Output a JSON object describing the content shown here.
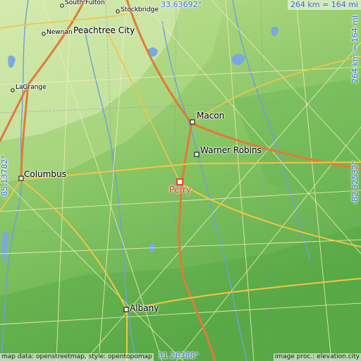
{
  "map": {
    "scale_label": "264 km = 164 mi",
    "coords": {
      "top": "33.63692°",
      "bottom": "31.26388°",
      "left": "-85.13782°",
      "right": "-82.32532°"
    },
    "highlight": {
      "name": "Perry",
      "color": "#e8372e"
    },
    "cities": [
      {
        "key": "south_fulton",
        "name": "South Fulton",
        "size": "small"
      },
      {
        "key": "stockbridge",
        "name": "Stockbridge",
        "size": "small"
      },
      {
        "key": "newnan",
        "name": "Newnan",
        "size": "small"
      },
      {
        "key": "peachtree_city",
        "name": "Peachtree City",
        "size": "large"
      },
      {
        "key": "lagrange",
        "name": "LaGrange",
        "size": "small"
      },
      {
        "key": "macon",
        "name": "Macon",
        "size": "large"
      },
      {
        "key": "warner_robins",
        "name": "Warner Robins",
        "size": "large"
      },
      {
        "key": "columbus",
        "name": "Columbus",
        "size": "large"
      },
      {
        "key": "albany",
        "name": "Albany",
        "size": "large"
      }
    ],
    "attribution_left": "map data: openstreetmap, style: opentopomap",
    "attribution_right": "image proc.: elevation.city",
    "colors": {
      "lowland": "#6fb956",
      "midland": "#8fc765",
      "upland": "#c8e3a2",
      "water": "#7aa8e0",
      "highway": "#f4c542",
      "road": "#f5e8a0",
      "border": "#8a8aa8",
      "label_accent": "#3a6fd8"
    }
  }
}
